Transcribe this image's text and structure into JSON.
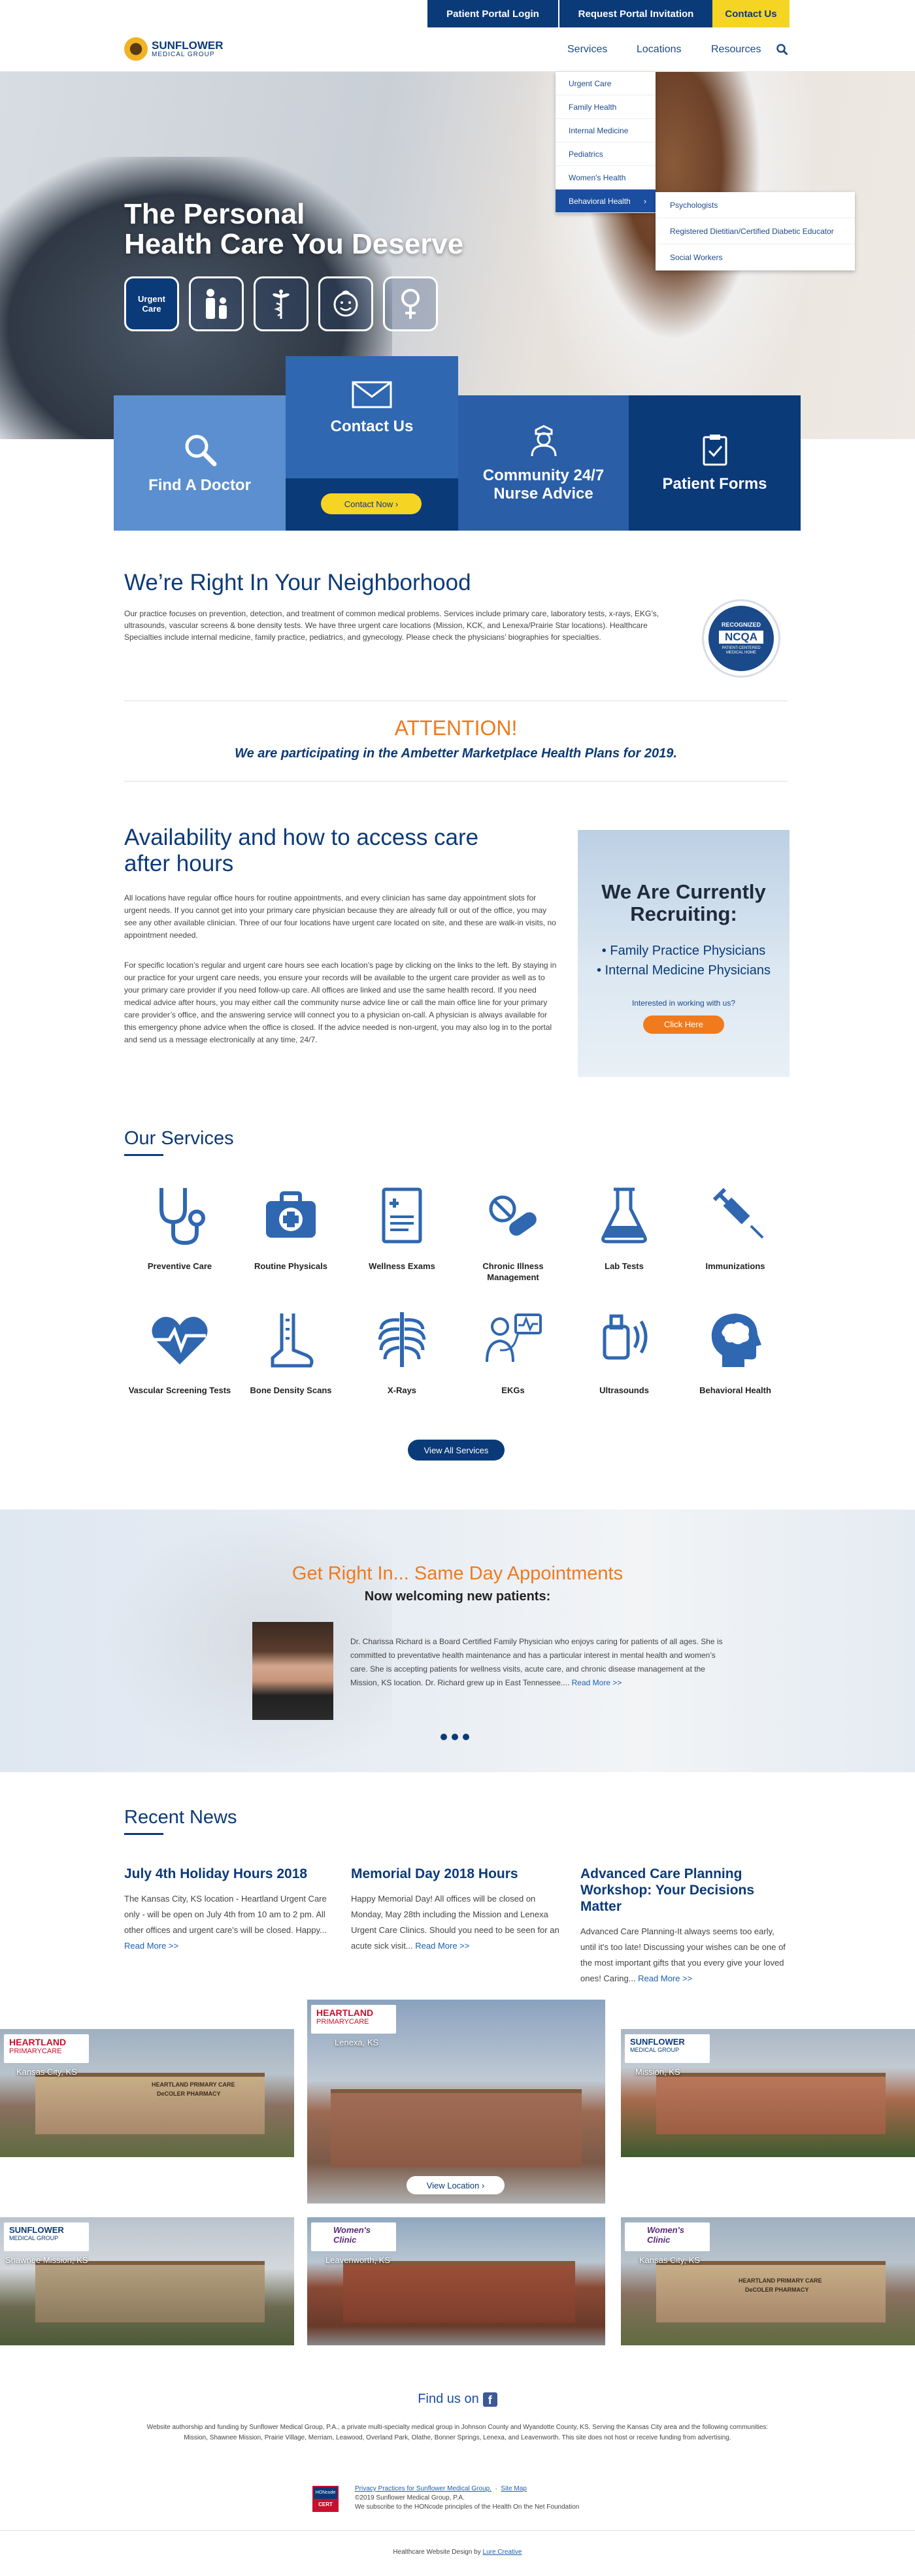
{
  "topbar": {
    "portal_login": "Patient Portal Login",
    "portal_invite": "Request Portal Invitation",
    "contact": "Contact Us"
  },
  "header": {
    "logo_line1": "SUNFLOWER",
    "logo_line2": "MEDICAL GROUP",
    "nav": {
      "services": "Services",
      "locations": "Locations",
      "resources": "Resources"
    }
  },
  "dropdown": {
    "items": [
      "Urgent Care",
      "Family Health",
      "Internal Medicine",
      "Pediatrics",
      "Women's Health",
      "Behavioral Health"
    ],
    "submenu": [
      "Psychologists",
      "Registered Dietitian/Certified Diabetic Educator",
      "Social Workers"
    ]
  },
  "hero": {
    "line1": "The Personal",
    "line2": "Health Care You Deserve",
    "icon_urgent_line1": "Urgent",
    "icon_urgent_line2": "Care"
  },
  "cta": {
    "find_doctor": "Find A Doctor",
    "contact_us": "Contact Us",
    "contact_now": "Contact Now",
    "nurse_line1": "Community 24/7",
    "nurse_line2": "Nurse Advice",
    "patient_forms": "Patient Forms"
  },
  "neighborhood": {
    "title": "We’re Right In Your Neighborhood",
    "text": "Our practice focuses on prevention, detection, and treatment of common medical problems. Services include primary care, laboratory tests, x-rays, EKG’s, ultrasounds, vascular screens & bone density tests. We have three urgent care locations (Mission, KCK, and Lenexa/Prairie Star locations). Healthcare Specialties include internal medicine, family practice, pediatrics, and gynecology. Please check the physicians’ biographies for specialties.",
    "badge_top": "RECOGNIZED",
    "badge_mid": "NCQA",
    "badge_bottom": "PATIENT-CENTERED MEDICAL HOME"
  },
  "attention": {
    "title": "ATTENTION!",
    "text": "We are participating in the Ambetter Marketplace Health Plans for 2019."
  },
  "availability": {
    "title_line1": "Availability and how to access care",
    "title_line2": "after hours",
    "p1": "All locations have regular office hours for routine appointments, and every clinician has same day appointment slots for urgent needs. If you cannot get into your primary care physician because they are already full or out of the office, you may see any other available clinician. Three of our four locations have urgent care located on site, and these are walk-in visits, no appointment needed.",
    "p2": "For specific location’s regular and urgent care hours see each location’s page by clicking on the links to the left. By staying in our practice for your urgent care needs, you ensure your records will be available to the urgent care provider as well as to your primary care provider if you need follow-up care. All offices are linked and use the same health record. If you need medical advice after hours, you may either call the community nurse advice line or call the main office line for your primary care provider’s office, and the answering service will connect you to a physician on-call. A physician is always available for this emergency phone advice when the office is closed. If the advice needed is non-urgent, you may also log in to the portal and send us a message electronically at any time, 24/7."
  },
  "recruit": {
    "title_line1": "We Are Currently",
    "title_line2": "Recruiting:",
    "item1": "• Family Practice Physicians",
    "item2": "• Internal Medicine Physicians",
    "question": "Interested in working with us?",
    "button": "Click Here"
  },
  "services": {
    "title": "Our Services",
    "items": [
      "Preventive Care",
      "Routine Physicals",
      "Wellness Exams",
      "Chronic Illness Management",
      "Lab Tests",
      "Immunizations",
      "Vascular Screening Tests",
      "Bone Density Scans",
      "X-Rays",
      "EKGs",
      "Ultrasounds",
      "Behavioral Health"
    ],
    "view_all": "View All Services"
  },
  "sameday": {
    "title": "Get Right In... Same Day Appointments",
    "subtitle": "Now welcoming new patients:",
    "bio": "Dr. Charissa Richard is a Board Certified Family Physician who enjoys caring for patients of all ages. She is committed to preventative health maintenance and has a particular interest in mental health and women’s care. She is accepting patients for wellness visits, acute care, and chronic disease management at the Mission, KS location. Dr. Richard grew up in East Tennessee....",
    "read_more": "Read More >>"
  },
  "news": {
    "title": "Recent News",
    "items": [
      {
        "title": "July 4th Holiday Hours 2018",
        "text": "The Kansas City, KS location - Heartland Urgent Care only - will be open on July 4th from 10 am to 2 pm. All other offices and urgent care's will be closed. Happy...",
        "more": "Read More >>"
      },
      {
        "title": "Memorial Day 2018 Hours",
        "text": "Happy Memorial Day! All offices will be closed on Monday, May 28th including the Mission and Lenexa Urgent Care Clinics. Should you need to be seen for an acute sick visit...",
        "more": "Read More >>"
      },
      {
        "title_line1": "Advanced Care Planning",
        "title_line2": "Workshop: Your Decisions Matter",
        "text": "Advanced Care Planning-It always seems too early, until it's too late! Discussing your wishes can be one of the most important gifts that you every give your loved ones! Caring...",
        "more": "Read More >>"
      }
    ]
  },
  "locations": {
    "items": [
      {
        "brand1": "HEARTLAND",
        "brand2": "PRIMARYCARE",
        "city": "Kansas City, KS",
        "sign1": "HEARTLAND PRIMARY CARE",
        "sign2": "DeCOLER PHARMACY"
      },
      {
        "brand1": "HEARTLAND",
        "brand2": "PRIMARYCARE",
        "city": "Lenexa, KS",
        "button": "View Location"
      },
      {
        "brand1": "SUNFLOWER",
        "brand2": "MEDICAL GROUP",
        "city": "Mission, KS"
      },
      {
        "brand1": "SUNFLOWER",
        "brand2": "MEDICAL GROUP",
        "city": "Shawnee Mission, KS"
      },
      {
        "brand1": "Women's",
        "brand2": "Clinic",
        "city": "Leavenworth, KS"
      },
      {
        "brand1": "Women's",
        "brand2": "Clinic",
        "city": "Kansas City, KS",
        "sign1": "HEARTLAND PRIMARY CARE",
        "sign2": "DeCOLER PHARMACY"
      }
    ]
  },
  "footer": {
    "find_us": "Find us on",
    "disclaimer": "Website authorship and funding by Sunflower Medical Group, P.A., a private multi-specialty medical group in Johnson County and Wyandotte County, KS. Serving the Kansas City area and the following communities: Mission, Shawnee Mission, Prairie Village, Merriam, Leawood, Overland Park, Olathe, Bonner Springs, Lenexa, and Leavenworth. This site does not host or receive funding from advertising.",
    "privacy": "Privacy Practices for Sunflower Medical Group.",
    "sitemap": "Site Map",
    "copyright": "©2019 Sunflower Medical Group, P.A.",
    "hon": "We subscribe to the HONcode principles of the Health On the Net Foundation",
    "hon_badge1": "HONcode",
    "hon_badge2": "CERT",
    "design_prefix": "Healthcare Website Design by",
    "design_link": "Lure Creative"
  },
  "colors": {
    "navy": "#0b3a78",
    "blue": "#2f67b0",
    "yellow": "#f5d423",
    "orange": "#f07a1c"
  }
}
